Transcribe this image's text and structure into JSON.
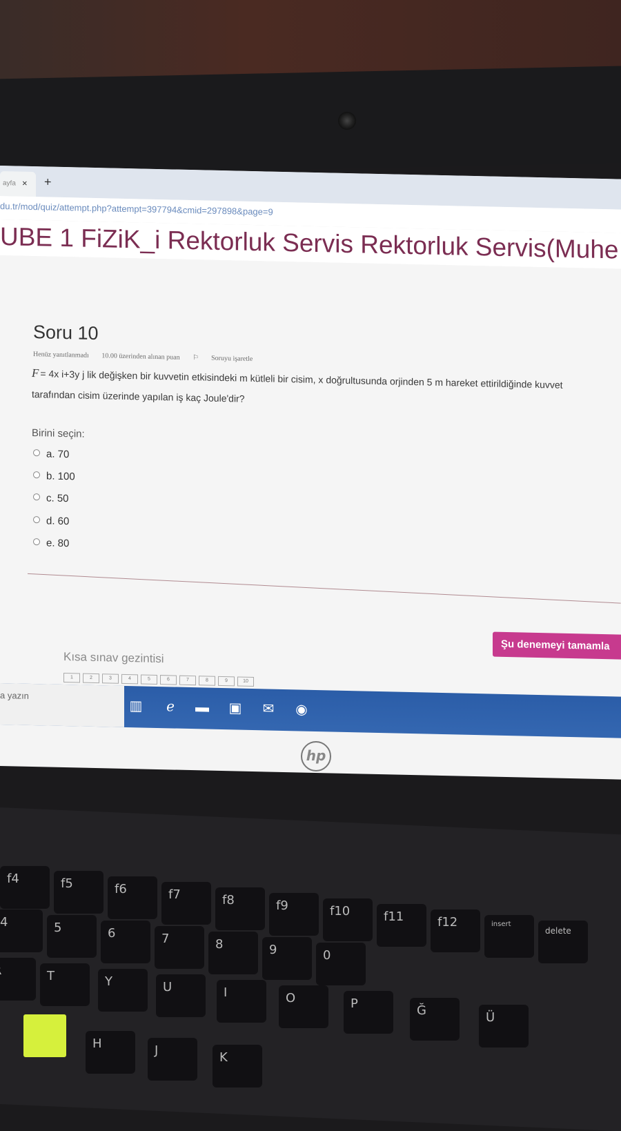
{
  "browser": {
    "tab_title": "ayfa",
    "tab_close": "×",
    "new_tab": "+",
    "url": "du.tr/mod/quiz/attempt.php?attempt=397794&cmid=297898&page=9"
  },
  "course": {
    "title": "UBE 1 FiZiK_i Rektorluk Servis Rektorluk Servis(Muhe"
  },
  "question": {
    "number": "Soru 10",
    "status": "Henüz yanıtlanmadı",
    "points": "10.00 üzerinden alınan puan",
    "flag_label": "Soruyu işaretle",
    "text_line1": "= 4x i+3y j lik değişken bir kuvvetin etkisindeki m kütleli bir cisim, x doğrultusunda orjinden 5 m hareket ettirildiğinde kuvvet",
    "text_line2": "tarafından cisim üzerinde yapılan iş kaç Joule'dir?",
    "force_symbol": "F",
    "prompt": "Birini seçin:",
    "options": [
      "a. 70",
      "b. 100",
      "c. 50",
      "d. 60",
      "e. 80"
    ]
  },
  "navigation": {
    "title": "Kısa sınav gezintisi",
    "boxes": [
      "1",
      "2",
      "3",
      "4",
      "5",
      "6",
      "7",
      "8",
      "9",
      "10"
    ]
  },
  "finish_button": "Şu denemeyi tamamla",
  "taskbar": {
    "search_text": "a yazın"
  },
  "keyboard": {
    "keys": [
      "f4",
      "f5",
      "f6",
      "f7",
      "f8",
      "f9",
      "f10",
      "f11",
      "f12",
      "insert",
      "delete",
      "4",
      "5",
      "6",
      "7",
      "8",
      "9",
      "0",
      "R",
      "T",
      "Y",
      "U",
      "I",
      "O",
      "P",
      "Ğ",
      "Ü",
      "H",
      "J",
      "K"
    ]
  },
  "colors": {
    "accent": "#c73a8e",
    "title": "#7b2d52",
    "taskbar": "#2b5da8"
  }
}
